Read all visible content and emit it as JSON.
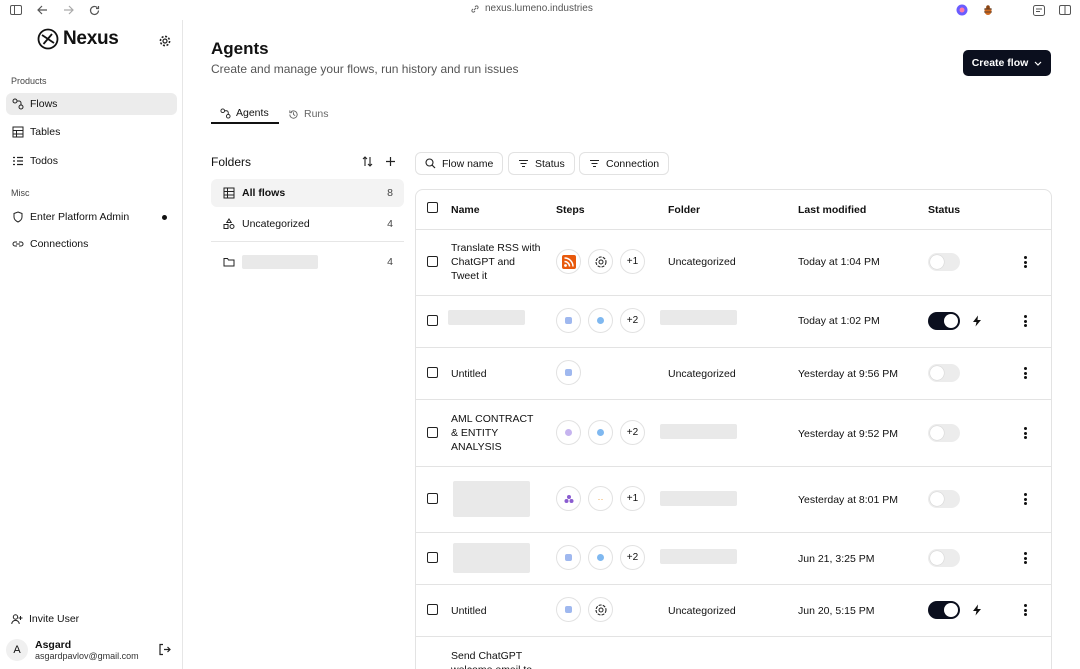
{
  "browser": {
    "url": "nexus.lumeno.industries"
  },
  "app": {
    "name": "Nexus"
  },
  "sidebar": {
    "products_label": "Products",
    "misc_label": "Misc",
    "items": [
      {
        "label": "Flows"
      },
      {
        "label": "Tables"
      },
      {
        "label": "Todos"
      },
      {
        "label": "Enter Platform Admin"
      },
      {
        "label": "Connections"
      }
    ],
    "invite_label": "Invite User",
    "user": {
      "initial": "A",
      "name": "Asgard",
      "email": "asgardpavlov@gmail.com"
    }
  },
  "page": {
    "title": "Agents",
    "subtitle": "Create and manage your flows, run history and run issues",
    "create_label": "Create flow",
    "tabs": [
      {
        "label": "Agents"
      },
      {
        "label": "Runs"
      }
    ]
  },
  "folders": {
    "title": "Folders",
    "items": [
      {
        "label": "All flows",
        "count": "8"
      },
      {
        "label": "Uncategorized",
        "count": "4"
      },
      {
        "label": "",
        "count": "4"
      }
    ]
  },
  "filters": [
    {
      "label": "Flow name"
    },
    {
      "label": "Status"
    },
    {
      "label": "Connection"
    }
  ],
  "table": {
    "headers": {
      "name": "Name",
      "steps": "Steps",
      "folder": "Folder",
      "modified": "Last modified",
      "status": "Status"
    },
    "rows": [
      {
        "name": "Translate RSS with ChatGPT and Tweet it",
        "extra": "+1",
        "folder": "Uncategorized",
        "modified": "Today at 1:04 PM",
        "enabled": false
      },
      {
        "name": "",
        "extra": "+2",
        "folder": "",
        "modified": "Today at 1:02 PM",
        "enabled": true
      },
      {
        "name": "Untitled",
        "extra": "",
        "folder": "Uncategorized",
        "modified": "Yesterday at 9:56 PM",
        "enabled": false
      },
      {
        "name": "AML CONTRACT & ENTITY ANALYSIS",
        "extra": "+2",
        "folder": "",
        "modified": "Yesterday at 9:52 PM",
        "enabled": false
      },
      {
        "name": "",
        "extra": "+1",
        "folder": "",
        "modified": "Yesterday at 8:01 PM",
        "enabled": false
      },
      {
        "name": "",
        "extra": "+2",
        "folder": "",
        "modified": "Jun 21, 3:25 PM",
        "enabled": false
      },
      {
        "name": "Untitled",
        "extra": "",
        "folder": "Uncategorized",
        "modified": "Jun 20, 5:15 PM",
        "enabled": true
      },
      {
        "name": "Send ChatGPT welcome email to",
        "extra": "",
        "folder": "",
        "modified": "",
        "enabled": false
      }
    ]
  }
}
